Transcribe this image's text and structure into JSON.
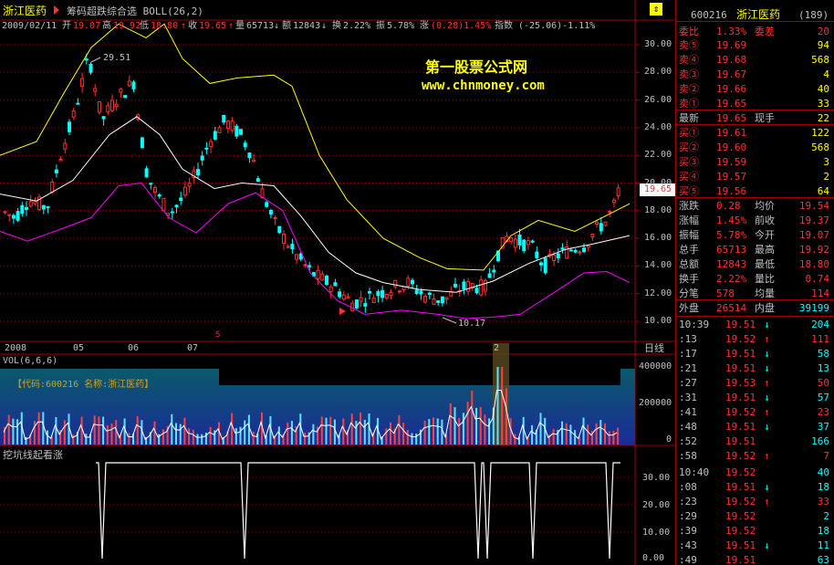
{
  "colors": {
    "up": "#ff3030",
    "down": "#00ffff",
    "yellow": "#ffff00",
    "white": "#ffffff",
    "magenta": "#ff00ff",
    "label": "#c0c0c0",
    "grid": "#a00000"
  },
  "titlebar": {
    "stock_name": "浙江医药",
    "indicator": "筹码超跌综合选 BOLL(26,2)"
  },
  "infobar": {
    "date": "2009/02/11",
    "open_label": "开",
    "open": "19.07",
    "high_label": "高",
    "high": "19.92",
    "low_label": "低",
    "low": "18.80",
    "close_label": "收",
    "close": "19.65",
    "vol_label": "量",
    "vol": "65713",
    "amt_label": "额",
    "amt": "12843",
    "turn_label": "换",
    "turn": "2.22%",
    "amp_label": "振",
    "amp": "5.78%",
    "chg_label": "涨",
    "chg": "(0.28)1.45%",
    "idx_label": "指数",
    "idx": "(-25.06)-1.11%"
  },
  "watermark": {
    "line1": "第一股票公式网",
    "line2": "www.chnmoney.com"
  },
  "annotations": {
    "high_marker": "29.51",
    "low_marker": "10.17",
    "current_price": "19.65",
    "s_mark": "S"
  },
  "price_axis": [
    "30.00",
    "28.00",
    "26.00",
    "24.00",
    "22.00",
    "20.00",
    "18.00",
    "16.00",
    "14.00",
    "12.00",
    "10.00"
  ],
  "time_axis": {
    "labels": [
      "2008",
      "05",
      "06",
      "07",
      "2"
    ],
    "period": "日线"
  },
  "vol_panel": {
    "title": "VOL(6,6,6)",
    "legend": "【代码:600216 名称:浙江医药】",
    "axis": [
      "400000",
      "200000",
      "0"
    ]
  },
  "indicator_panel": {
    "title": "挖坑线起看涨",
    "axis": [
      "30.00",
      "20.00",
      "10.00",
      "0.00"
    ]
  },
  "quote": {
    "code": "600216",
    "name": "浙江医药",
    "count": "(189)",
    "webi_label": "委比",
    "webi": "1.33%",
    "weicha_label": "委差",
    "weicha": "20",
    "sell": [
      {
        "label": "卖⑤",
        "price": "19.69",
        "vol": "94"
      },
      {
        "label": "卖④",
        "price": "19.68",
        "vol": "568"
      },
      {
        "label": "卖③",
        "price": "19.67",
        "vol": "4"
      },
      {
        "label": "卖②",
        "price": "19.66",
        "vol": "40"
      },
      {
        "label": "卖①",
        "price": "19.65",
        "vol": "33"
      }
    ],
    "last_label": "最新",
    "last": "19.65",
    "cur_label": "现手",
    "cur": "22",
    "buy": [
      {
        "label": "买①",
        "price": "19.61",
        "vol": "122"
      },
      {
        "label": "买②",
        "price": "19.60",
        "vol": "568"
      },
      {
        "label": "买③",
        "price": "19.59",
        "vol": "3"
      },
      {
        "label": "买④",
        "price": "19.57",
        "vol": "2"
      },
      {
        "label": "买⑤",
        "price": "19.56",
        "vol": "64"
      }
    ],
    "stats": [
      {
        "l1": "涨跌",
        "v1": "0.28",
        "l2": "均价",
        "v2": "19.54"
      },
      {
        "l1": "涨幅",
        "v1": "1.45%",
        "l2": "前收",
        "v2": "19.37"
      },
      {
        "l1": "振幅",
        "v1": "5.78%",
        "l2": "今开",
        "v2": "19.07"
      },
      {
        "l1": "总手",
        "v1": "65713",
        "l2": "最高",
        "v2": "19.92"
      },
      {
        "l1": "总额",
        "v1": "12843",
        "l2": "最低",
        "v2": "18.80"
      },
      {
        "l1": "换手",
        "v1": "2.22%",
        "l2": "量比",
        "v2": "0.74"
      },
      {
        "l1": "分笔",
        "v1": "578",
        "l2": "均量",
        "v2": "114"
      }
    ],
    "outer_label": "外盘",
    "outer": "26514",
    "inner_label": "内盘",
    "inner": "39199"
  },
  "ticks": [
    {
      "time": "10:39",
      "price": "19.51",
      "dir": "↓",
      "vol": "204"
    },
    {
      "time": ":13",
      "price": "19.52",
      "dir": "↑",
      "vol": "111"
    },
    {
      "time": ":17",
      "price": "19.51",
      "dir": "↓",
      "vol": "58"
    },
    {
      "time": ":21",
      "price": "19.51",
      "dir": "↓",
      "vol": "13"
    },
    {
      "time": ":27",
      "price": "19.53",
      "dir": "↑",
      "vol": "50"
    },
    {
      "time": ":31",
      "price": "19.51",
      "dir": "↓",
      "vol": "57"
    },
    {
      "time": ":41",
      "price": "19.52",
      "dir": "↑",
      "vol": "23"
    },
    {
      "time": ":48",
      "price": "19.51",
      "dir": "↓",
      "vol": "37"
    },
    {
      "time": ":52",
      "price": "19.51",
      "dir": "",
      "vol": "166"
    },
    {
      "time": ":58",
      "price": "19.52",
      "dir": "↑",
      "vol": "7"
    },
    {
      "time": "10:40",
      "price": "19.52",
      "dir": "",
      "vol": "40"
    },
    {
      "time": ":08",
      "price": "19.51",
      "dir": "↓",
      "vol": "18"
    },
    {
      "time": ":23",
      "price": "19.52",
      "dir": "↑",
      "vol": "33"
    },
    {
      "time": ":29",
      "price": "19.52",
      "dir": "",
      "vol": "2"
    },
    {
      "time": ":39",
      "price": "19.52",
      "dir": "",
      "vol": "18"
    },
    {
      "time": ":43",
      "price": "19.51",
      "dir": "↓",
      "vol": "11"
    },
    {
      "time": ":49",
      "price": "19.51",
      "dir": "",
      "vol": "63"
    }
  ]
}
